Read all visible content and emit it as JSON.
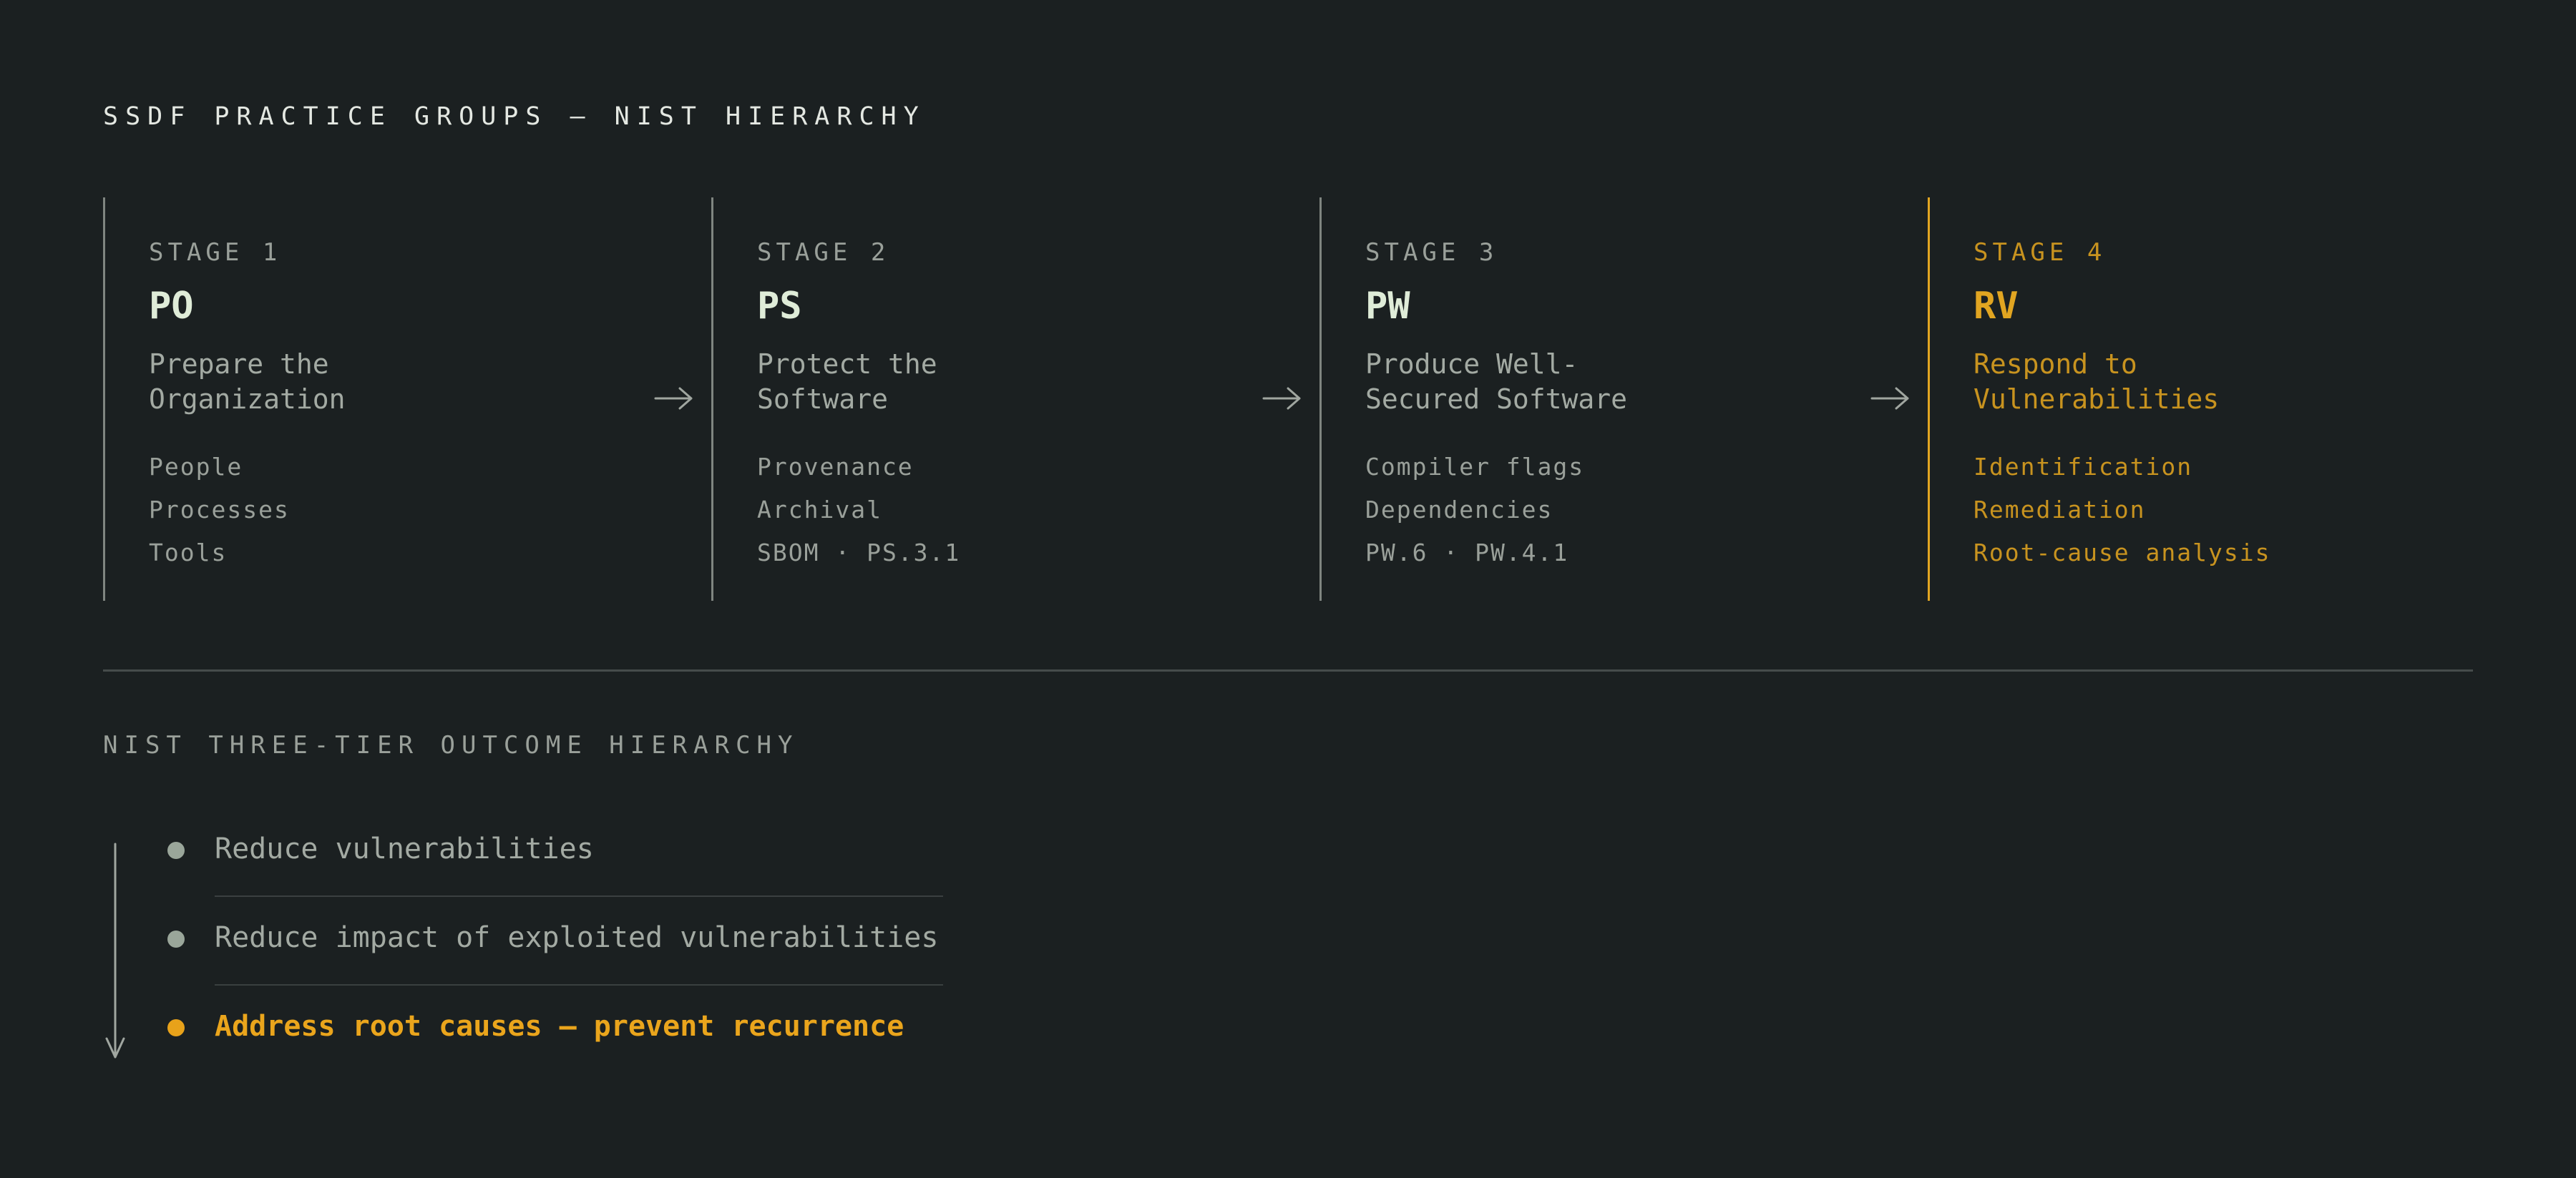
{
  "header": {
    "title": "SSDF PRACTICE GROUPS — NIST HIERARCHY"
  },
  "stages": [
    {
      "label": "STAGE 1",
      "code": "PO",
      "name_line1": "Prepare the",
      "name_line2": "Organization",
      "items": [
        "People",
        "Processes",
        "Tools"
      ],
      "highlighted": false
    },
    {
      "label": "STAGE 2",
      "code": "PS",
      "name_line1": "Protect the",
      "name_line2": "Software",
      "items": [
        "Provenance",
        "Archival",
        "SBOM · PS.3.1"
      ],
      "highlighted": false
    },
    {
      "label": "STAGE 3",
      "code": "PW",
      "name_line1": "Produce Well-",
      "name_line2": "Secured Software",
      "items": [
        "Compiler flags",
        "Dependencies",
        "PW.6 · PW.4.1"
      ],
      "highlighted": false
    },
    {
      "label": "STAGE 4",
      "code": "RV",
      "name_line1": "Respond to",
      "name_line2": "Vulnerabilities",
      "items": [
        "Identification",
        "Remediation",
        "Root-cause analysis"
      ],
      "highlighted": true
    }
  ],
  "hierarchy": {
    "title": "NIST THREE-TIER OUTCOME HIERARCHY",
    "tiers": [
      {
        "text": "Reduce vulnerabilities",
        "highlighted": false
      },
      {
        "text": "Reduce impact of exploited vulnerabilities",
        "highlighted": false
      },
      {
        "text": "Address root causes — prevent recurrence",
        "highlighted": true
      }
    ]
  },
  "colors": {
    "background": "#1b2021",
    "accent": "#e1a521",
    "text_muted": "#9aa09a",
    "code_text": "#dfecd8",
    "border": "#7f8580"
  },
  "icons": {
    "stage_connector": "arrow-right-icon",
    "hierarchy_direction": "arrow-down-icon",
    "tier_marker": "dot-icon"
  }
}
